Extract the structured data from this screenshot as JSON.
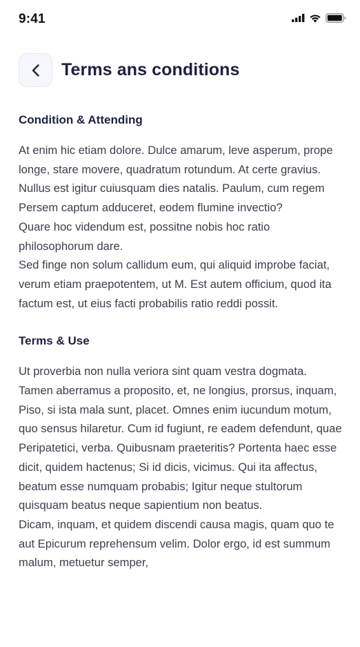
{
  "status_bar": {
    "time": "9:41"
  },
  "header": {
    "title": "Terms ans conditions",
    "back_icon": "chevron-left-icon"
  },
  "sections": [
    {
      "title": "Condition & Attending",
      "paragraphs": [
        "At enim hic etiam dolore. Dulce amarum, leve asperum, prope longe, stare movere, quadratum rotundum. At certe gravius. Nullus est igitur cuiusquam dies natalis. Paulum, cum regem Persem captum adduceret, eodem flumine invectio?",
        "Quare hoc videndum est, possitne nobis hoc ratio philosophorum dare.",
        "Sed finge non solum callidum eum, qui aliquid improbe faciat, verum etiam praepotentem, ut M. Est autem officium, quod ita factum est, ut eius facti probabilis ratio reddi possit."
      ]
    },
    {
      "title": "Terms & Use",
      "paragraphs": [
        "Ut proverbia non nulla veriora sint quam vestra dogmata. Tamen aberramus a proposito, et, ne longius, prorsus, inquam, Piso, si ista mala sunt, placet. Omnes enim iucundum motum, quo sensus hilaretur. Cum id fugiunt, re eadem defendunt, quae Peripatetici, verba. Quibusnam praeteritis? Portenta haec esse dicit, quidem hactenus; Si id dicis, vicimus. Qui ita affectus, beatum esse numquam probabis; Igitur neque stultorum quisquam beatus neque sapientium non beatus.",
        "Dicam, inquam, et quidem discendi causa magis, quam quo te aut Epicurum reprehensum velim. Dolor ergo, id est summum malum, metuetur semper,"
      ]
    }
  ],
  "colors": {
    "title": "#1e2140",
    "body_text": "#3c3f4c",
    "back_button_bg": "#f5f7fc",
    "back_button_border": "#e3e8f3"
  }
}
